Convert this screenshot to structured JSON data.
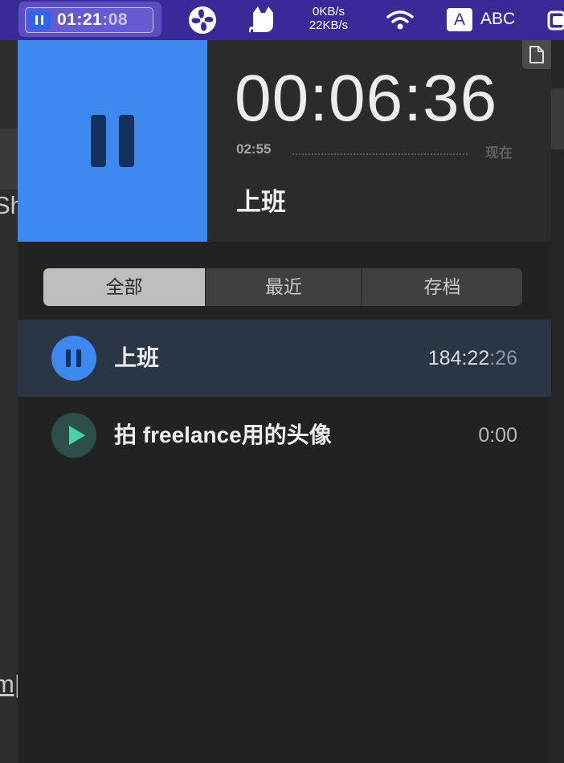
{
  "menubar": {
    "timer": {
      "hours_minutes": "01:21",
      "seconds": ":08"
    },
    "network": {
      "upload": "0KB/s",
      "download": "22KB/s"
    },
    "input_method": {
      "icon_letter": "A",
      "label": "ABC"
    },
    "icons": [
      "fan-icon",
      "cat-icon",
      "wifi-icon",
      "clipboard-icon"
    ],
    "colors": {
      "bar": "#3a2a98",
      "accent": "#2f66e9"
    }
  },
  "background_app": {
    "upper_text": "Sh",
    "lower_text": "m|"
  },
  "current": {
    "elapsed": "00:06:36",
    "start_time": "02:55",
    "now_label": "现在",
    "name": "上班",
    "accent_color": "#3d89f0"
  },
  "tabs": [
    {
      "label": "全部",
      "selected": true
    },
    {
      "label": "最近",
      "selected": false
    },
    {
      "label": "存档",
      "selected": false
    }
  ],
  "tasks": [
    {
      "name": "上班",
      "time_main": "184:22",
      "time_seconds": ":26",
      "running": true
    },
    {
      "name": "拍 freelance用的头像",
      "time_main": "0:00",
      "time_seconds": "",
      "running": false
    }
  ]
}
